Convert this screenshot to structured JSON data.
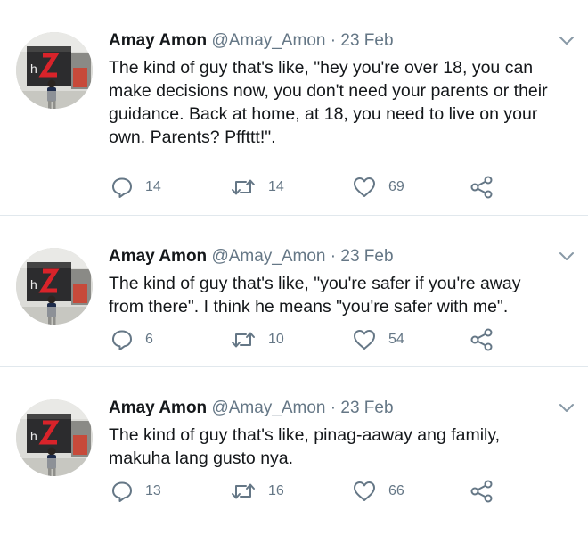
{
  "tweets": [
    {
      "author_name": "Amay Amon",
      "handle": "@Amay_Amon",
      "separator": "·",
      "date": "23 Feb",
      "text": "The kind of guy that's like, \"hey you're over 18, you can make decisions now, you don't need your parents or their guidance. Back at home, at 18, you need to live on your own. Parents? Pffttt!\".",
      "replies": "14",
      "retweets": "14",
      "likes": "69"
    },
    {
      "author_name": "Amay Amon",
      "handle": "@Amay_Amon",
      "separator": "·",
      "date": "23 Feb",
      "text": "The kind of guy that's like, \"you're safer if you're away from there\". I think he means \"you're safer with me\".",
      "replies": "6",
      "retweets": "10",
      "likes": "54"
    },
    {
      "author_name": "Amay Amon",
      "handle": "@Amay_Amon",
      "separator": "·",
      "date": "23 Feb",
      "text": "The kind of guy that's like, pinag-aaway ang family, makuha lang gusto nya.",
      "replies": "13",
      "retweets": "16",
      "likes": "66"
    }
  ],
  "icons": {
    "reply": "reply-icon",
    "retweet": "retweet-icon",
    "like": "heart-icon",
    "share": "share-icon",
    "menu": "chevron-down-icon"
  },
  "colors": {
    "text": "#14171a",
    "muted": "#657786",
    "divider": "#e1e8ed"
  }
}
